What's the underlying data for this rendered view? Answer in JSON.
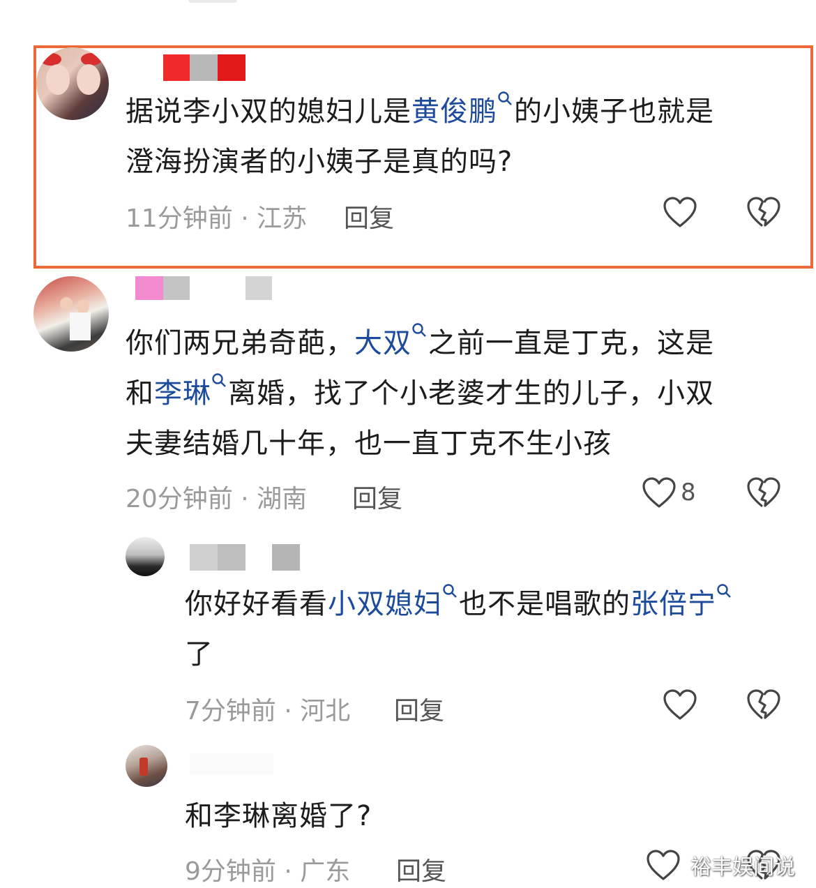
{
  "comments": [
    {
      "text_parts": [
        "据说李小双的媳妇儿是",
        "黄俊鹏",
        "的小姨子也就是",
        "澄海扮演者的小姨子是真的吗?"
      ],
      "time": "11分钟前",
      "location": "江苏",
      "reply_label": "回复",
      "like_count": ""
    },
    {
      "text_parts": [
        "你们两兄弟奇葩，",
        "大双",
        "之前一直是丁克，这是",
        "和",
        "李琳",
        "离婚，找了个小老婆才生的儿子，小双",
        "夫妻结婚几十年，也一直丁克不生小孩"
      ],
      "time": "20分钟前",
      "location": "湖南",
      "reply_label": "回复",
      "like_count": "8"
    },
    {
      "text_parts": [
        "你好好看看",
        "小双媳妇",
        "也不是唱歌的",
        "张倍宁",
        "了"
      ],
      "time": "7分钟前",
      "location": "河北",
      "reply_label": "回复",
      "like_count": ""
    },
    {
      "text_parts": [
        "和李琳离婚了?"
      ],
      "time": "9分钟前",
      "location": "广东",
      "reply_label": "回复",
      "like_count": ""
    }
  ],
  "separator": "·",
  "watermark": "裕丰娱间说",
  "colors": {
    "highlight_border": "#ec6a3a",
    "link": "#1d4b9c",
    "meta": "#9a9a9a"
  },
  "icons": {
    "like": "heart-outline-icon",
    "dislike": "broken-heart-icon",
    "search": "search-icon"
  }
}
